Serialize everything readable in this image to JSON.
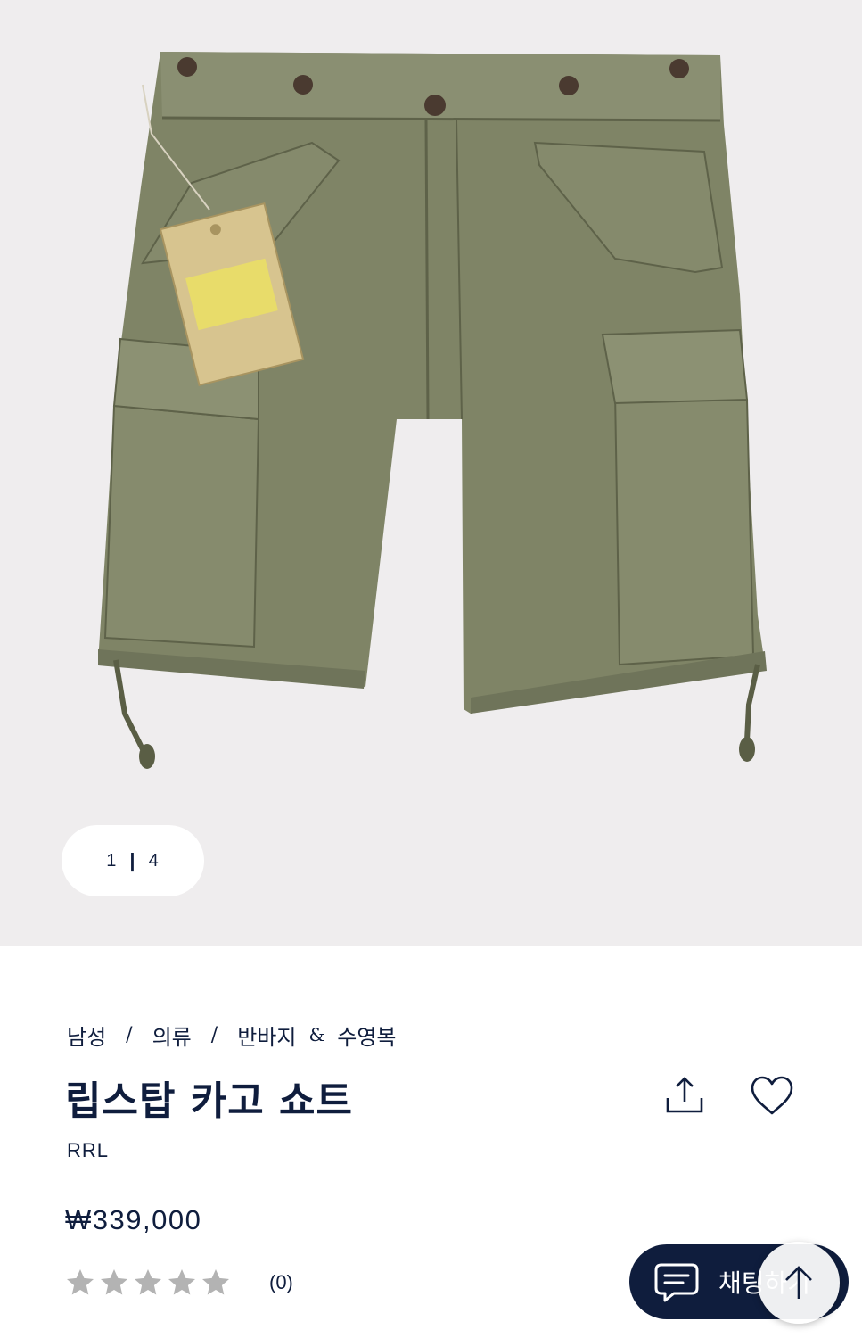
{
  "gallery": {
    "current_index": "1",
    "separator": "|",
    "total": "4"
  },
  "breadcrumb": {
    "level1": "남성",
    "level2": "의류",
    "level3a": "반바지",
    "ampersand": "&",
    "level3b": "수영복",
    "divider": "/"
  },
  "product": {
    "title": "립스탑 카고 쇼트",
    "brand": "RRL",
    "price": "₩339,000",
    "rating_stars": 0,
    "rating_max": 5,
    "review_count": "(0)"
  },
  "icons": {
    "share": "share-upload-icon",
    "favorite": "heart-icon",
    "chat": "chat-bubble-icon",
    "scroll_top": "arrow-up-icon"
  },
  "chat": {
    "label": "채팅하기"
  },
  "colors": {
    "navy": "#0f1d3d",
    "hero_bg": "#efedee",
    "olive": "#7f8466",
    "star_empty": "#b3b3b3"
  }
}
